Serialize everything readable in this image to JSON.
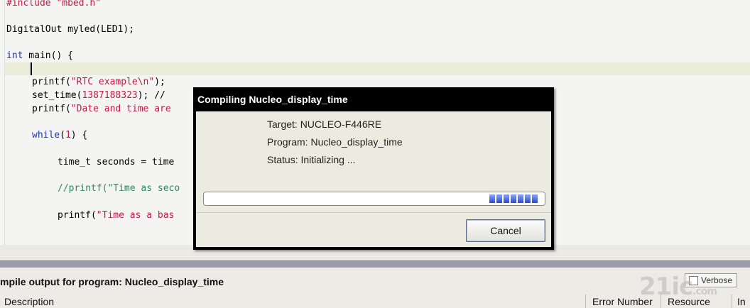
{
  "editor": {
    "lines": {
      "l1": {
        "text": "#include \"mbed.h\""
      },
      "l3": {
        "text": "DigitalOut myled(LED1);"
      },
      "l5": {
        "kw": "int",
        "rest": " main() {"
      },
      "l7": {
        "fn": "printf(",
        "str": "\"RTC example\\n\"",
        "rest": ");"
      },
      "l8": {
        "fn": "set_time(",
        "num": "1387188323",
        "rest": "); // "
      },
      "l9": {
        "fn": "printf(",
        "str": "\"Date and time are"
      },
      "l11": {
        "kw": "while",
        "mid": "(",
        "num": "1",
        "rest": ") {"
      },
      "l13": {
        "text": "time_t seconds = time"
      },
      "l15": {
        "cmt": "//printf(\"Time as seco"
      },
      "l17": {
        "fn": "printf(",
        "str": "\"Time as a bas"
      }
    }
  },
  "dialog": {
    "title": "Compiling Nucleo_display_time",
    "target": "Target: NUCLEO-F446RE",
    "program": "Program: Nucleo_display_time",
    "status": "Status: Initializing ...",
    "cancel_label": "Cancel",
    "progress_segments": 7
  },
  "output": {
    "title": "mpile output for program: Nucleo_display_time",
    "verbose_label": "Verbose",
    "columns": [
      "Description",
      "Error Number",
      "Resource",
      "In"
    ]
  },
  "watermark": {
    "text": "21ic",
    "suffix": ".com"
  }
}
